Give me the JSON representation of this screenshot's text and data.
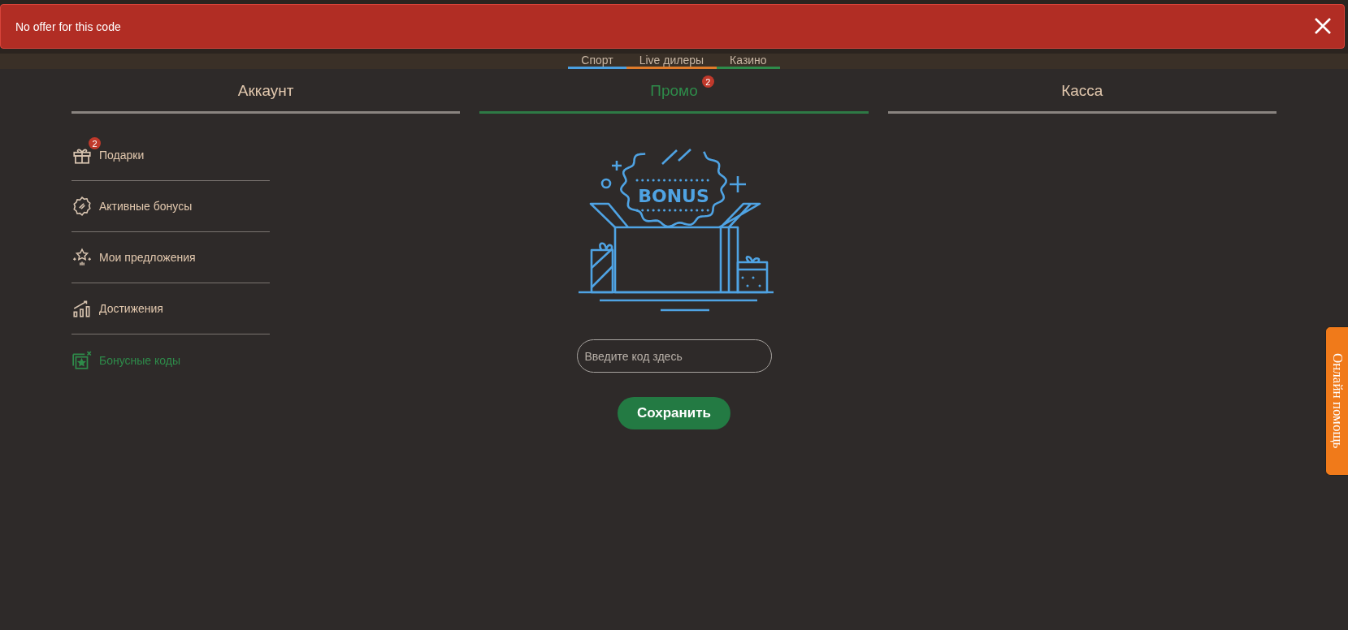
{
  "toast": {
    "message": "No offer for this code"
  },
  "categories": [
    {
      "label": "Спорт",
      "color": "#4a9fe0"
    },
    {
      "label": "Live дилеры",
      "color": "#e07b2a"
    },
    {
      "label": "Казино",
      "color": "#2e8b4a"
    }
  ],
  "tabs": [
    {
      "label": "Аккаунт",
      "selected": false
    },
    {
      "label": "Промо",
      "selected": true,
      "badge": "2"
    },
    {
      "label": "Касса",
      "selected": false
    }
  ],
  "sidebar": {
    "items": [
      {
        "label": "Подарки",
        "kind": "gift",
        "selected": false,
        "badge": "2"
      },
      {
        "label": "Активные бонусы",
        "kind": "badge",
        "selected": false
      },
      {
        "label": "Мои предложения",
        "kind": "stars",
        "selected": false
      },
      {
        "label": "Достижения",
        "kind": "chart",
        "selected": false
      },
      {
        "label": "Бонусные коды",
        "kind": "code",
        "selected": true
      }
    ]
  },
  "promo": {
    "illustration_label": "BONUS",
    "code_field": {
      "placeholder": "Введите код здесь"
    },
    "save_button": "Сохранить"
  },
  "help_tab": "Онлайн помощь"
}
